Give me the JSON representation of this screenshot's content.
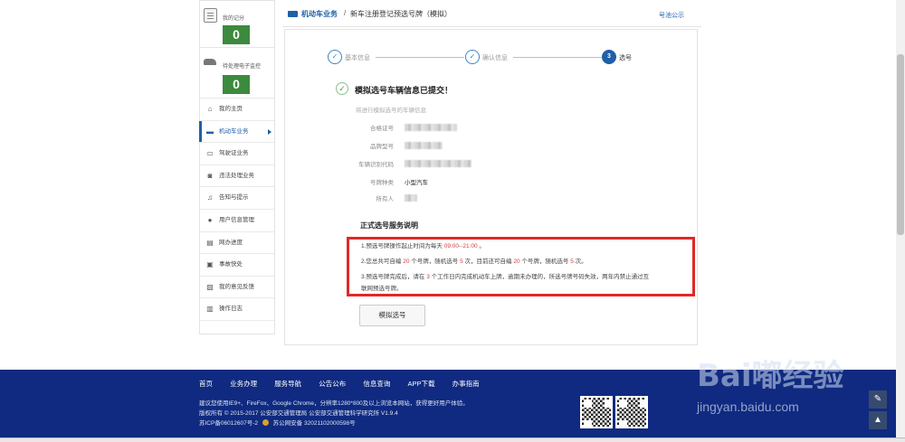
{
  "sidebar": {
    "score_label": "我的记分",
    "score_value": "0",
    "violation_label": "待处理电子监控",
    "violation_value": "0",
    "items": [
      {
        "label": "我的主页",
        "icon": "home-icon"
      },
      {
        "label": "机动车业务",
        "icon": "car-icon",
        "active": true
      },
      {
        "label": "驾驶证业务",
        "icon": "license-icon"
      },
      {
        "label": "违法处理业务",
        "icon": "camera-icon"
      },
      {
        "label": "告知与提示",
        "icon": "bell-icon"
      },
      {
        "label": "用户信息管理",
        "icon": "user-icon"
      },
      {
        "label": "网办进度",
        "icon": "progress-icon"
      },
      {
        "label": "事故快处",
        "icon": "accident-icon"
      },
      {
        "label": "我的意见反馈",
        "icon": "feedback-icon"
      },
      {
        "label": "操作日志",
        "icon": "log-icon"
      }
    ]
  },
  "header": {
    "crumb_main": "机动车业务",
    "crumb_sep": "/",
    "crumb_sub": "新车注册登记预选号牌（模拟）",
    "pool_link": "号池公示"
  },
  "steps": [
    {
      "label": "基本信息",
      "mark": "✓"
    },
    {
      "label": "确认信息",
      "mark": "✓"
    },
    {
      "label": "选号",
      "mark": "3"
    }
  ],
  "result": {
    "title": "模拟选号车辆信息已提交！",
    "hint": "将进行模拟选号的车辆信息"
  },
  "info": [
    {
      "label": "合格证号",
      "value": ""
    },
    {
      "label": "品牌型号",
      "value": ""
    },
    {
      "label": "车辆识别代码",
      "value": ""
    },
    {
      "label": "号牌种类",
      "value": "小型汽车"
    },
    {
      "label": "所有人",
      "value": ""
    }
  ],
  "rules": {
    "title": "正式选号服务说明",
    "r1_a": "1.预选号牌操作起止时间为每天 ",
    "r1_time": "09:00--21:00",
    "r1_b": " 。",
    "r2_a": "2.您总共可自编 ",
    "r2_n1": "20",
    "r2_b": " 个号牌，随机选号 ",
    "r2_n2": "5",
    "r2_c": " 次，目前还可自编 ",
    "r2_n3": "20",
    "r2_d": " 个号牌，随机选号 ",
    "r2_n4": "5",
    "r2_e": " 次。",
    "r3_a": "3.预选号牌完成后，请在 ",
    "r3_n": "3",
    "r3_b": " 个工作日内完成机动车上牌，逾期未办理的，所选号牌号码失效，两年内禁止通过互",
    "r3_c": "联网预选号牌。"
  },
  "button": {
    "simulate": "模拟选号"
  },
  "footer": {
    "links": [
      "首页",
      "业务办理",
      "服务导航",
      "公告公布",
      "信息查询",
      "APP下载",
      "办事指南"
    ],
    "line1": "建议您使用IE9+、FireFox、Google Chrome，分辨率1280*800及以上浏览本网站，获得更好用户体验。",
    "line2": "版权所有 © 2015-2017 公安部交通管理局 公安部交通管理科学研究所 V1.9.4",
    "line3_a": "苏ICP备06012607号-2",
    "line3_b": "苏公网安备 32021102000598号"
  },
  "watermark": {
    "brand": "Bai嘟经验",
    "url": "jingyan.baidu.com"
  },
  "tools": {
    "edit": "✎",
    "top": "▲"
  }
}
